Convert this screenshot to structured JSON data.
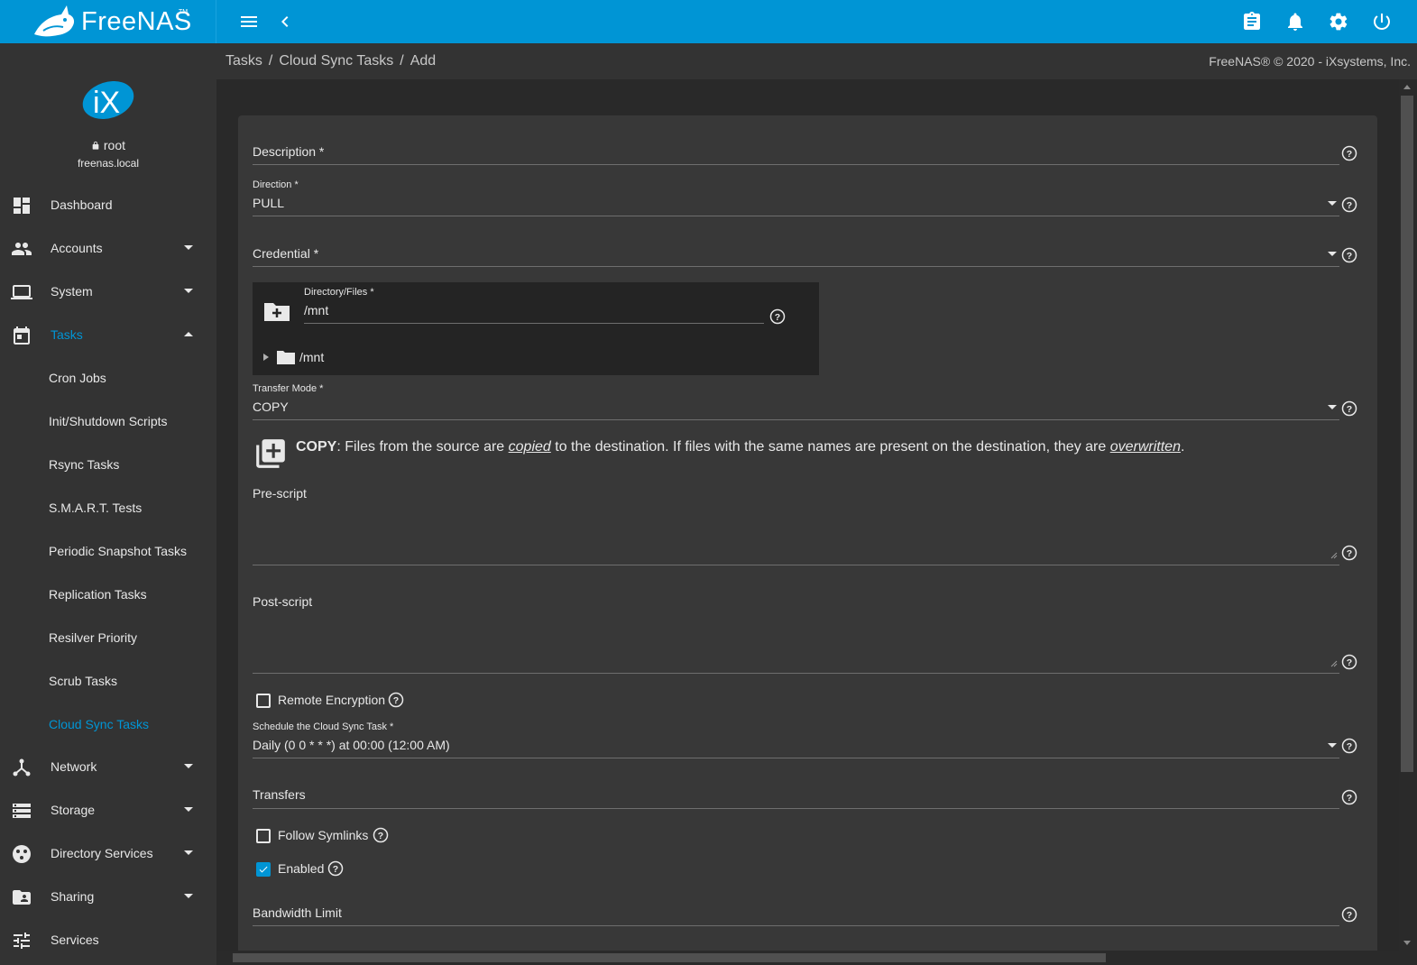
{
  "app": {
    "name": "FreeNAS",
    "copyright": "FreeNAS® © 2020 - iXsystems, Inc.",
    "accent": "#0095d5"
  },
  "user": {
    "name": "root",
    "host": "freenas.local"
  },
  "breadcrumb": [
    "Tasks",
    "Cloud Sync Tasks",
    "Add"
  ],
  "topbar_icons": [
    "menu-icon",
    "back-icon",
    "clipboard-icon",
    "bell-icon",
    "gear-icon",
    "power-icon"
  ],
  "sidebar": {
    "items": [
      {
        "label": "Dashboard",
        "icon": "dashboard-icon"
      },
      {
        "label": "Accounts",
        "icon": "people-icon"
      },
      {
        "label": "System",
        "icon": "laptop-icon"
      },
      {
        "label": "Tasks",
        "icon": "calendar-icon",
        "active": true
      },
      {
        "label": "Network",
        "icon": "network-icon"
      },
      {
        "label": "Storage",
        "icon": "storage-icon"
      },
      {
        "label": "Directory Services",
        "icon": "directory-icon"
      },
      {
        "label": "Sharing",
        "icon": "sharing-folder-icon"
      },
      {
        "label": "Services",
        "icon": "sliders-icon"
      }
    ],
    "task_subitems": [
      "Cron Jobs",
      "Init/Shutdown Scripts",
      "Rsync Tasks",
      "S.M.A.R.T. Tests",
      "Periodic Snapshot Tasks",
      "Replication Tasks",
      "Resilver Priority",
      "Scrub Tasks",
      "Cloud Sync Tasks"
    ]
  },
  "form": {
    "description": {
      "label": "Description *",
      "value": ""
    },
    "direction": {
      "label": "Direction *",
      "value": "PULL"
    },
    "credential": {
      "label": "Credential *",
      "value": ""
    },
    "directory": {
      "label": "Directory/Files *",
      "value": "/mnt",
      "tree_node": "/mnt"
    },
    "transfer_mode": {
      "label": "Transfer Mode *",
      "value": "COPY",
      "desc_bold": "COPY",
      "desc_1": ": Files from the source are ",
      "desc_em1": "copied",
      "desc_2": " to the destination. If files with the same names are present on the destination, they are ",
      "desc_em2": "overwritten",
      "desc_3": "."
    },
    "pre_script": {
      "label": "Pre-script",
      "value": ""
    },
    "post_script": {
      "label": "Post-script",
      "value": ""
    },
    "remote_encryption": {
      "label": "Remote Encryption",
      "checked": false
    },
    "schedule": {
      "label": "Schedule the Cloud Sync Task *",
      "value": "Daily (0 0 * * *) at 00:00 (12:00 AM)"
    },
    "transfers": {
      "label": "Transfers",
      "value": ""
    },
    "follow_symlinks": {
      "label": "Follow Symlinks",
      "checked": false
    },
    "enabled": {
      "label": "Enabled",
      "checked": true
    },
    "bandwidth_limit": {
      "label": "Bandwidth Limit",
      "value": ""
    }
  }
}
